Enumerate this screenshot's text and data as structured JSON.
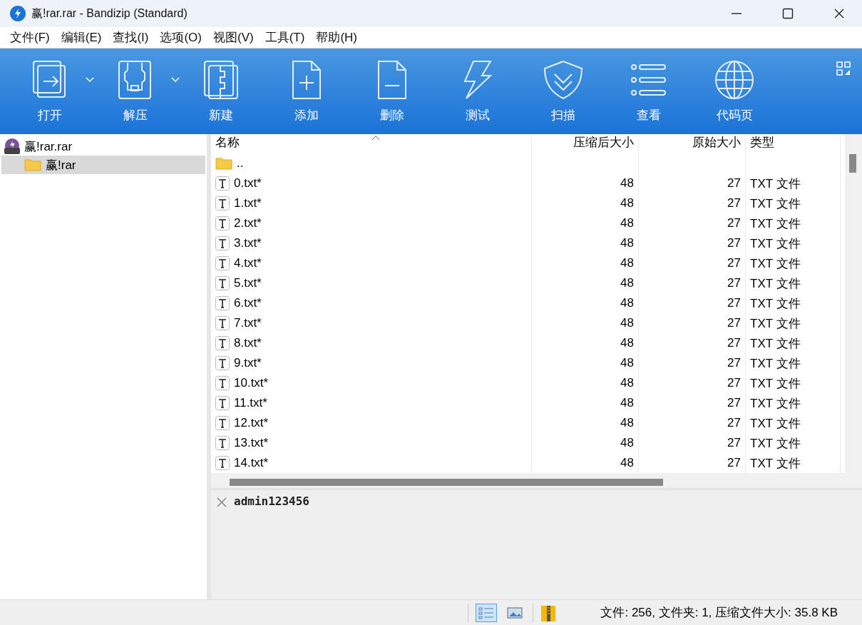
{
  "window": {
    "title": "赢!rar.rar - Bandizip (Standard)"
  },
  "menu": [
    "文件(F)",
    "编辑(E)",
    "查找(I)",
    "选项(O)",
    "视图(V)",
    "工具(T)",
    "帮助(H)"
  ],
  "toolbar": [
    {
      "label": "打开",
      "has_dropdown": true
    },
    {
      "label": "解压",
      "has_dropdown": true
    },
    {
      "label": "新建",
      "has_dropdown": false
    },
    {
      "label": "添加",
      "has_dropdown": false
    },
    {
      "label": "删除",
      "has_dropdown": false
    },
    {
      "label": "测试",
      "has_dropdown": false
    },
    {
      "label": "扫描",
      "has_dropdown": false
    },
    {
      "label": "查看",
      "has_dropdown": false
    },
    {
      "label": "代码页",
      "has_dropdown": false
    }
  ],
  "tree": [
    {
      "label": "赢!rar.rar",
      "selected": false,
      "children": [
        {
          "label": "赢!rar",
          "selected": true
        }
      ]
    }
  ],
  "table": {
    "columns": [
      {
        "label": "名称",
        "sorted": true
      },
      {
        "label": "压缩后大小",
        "sorted": false
      },
      {
        "label": "原始大小",
        "sorted": false
      },
      {
        "label": "类型",
        "sorted": false
      }
    ],
    "rows": [
      {
        "kind": "parent",
        "name": "..",
        "packed": "",
        "original": "",
        "type": ""
      },
      {
        "kind": "file",
        "name": "0.txt*",
        "packed": "48",
        "original": "27",
        "type": "TXT 文件"
      },
      {
        "kind": "file",
        "name": "1.txt*",
        "packed": "48",
        "original": "27",
        "type": "TXT 文件"
      },
      {
        "kind": "file",
        "name": "2.txt*",
        "packed": "48",
        "original": "27",
        "type": "TXT 文件"
      },
      {
        "kind": "file",
        "name": "3.txt*",
        "packed": "48",
        "original": "27",
        "type": "TXT 文件"
      },
      {
        "kind": "file",
        "name": "4.txt*",
        "packed": "48",
        "original": "27",
        "type": "TXT 文件"
      },
      {
        "kind": "file",
        "name": "5.txt*",
        "packed": "48",
        "original": "27",
        "type": "TXT 文件"
      },
      {
        "kind": "file",
        "name": "6.txt*",
        "packed": "48",
        "original": "27",
        "type": "TXT 文件"
      },
      {
        "kind": "file",
        "name": "7.txt*",
        "packed": "48",
        "original": "27",
        "type": "TXT 文件"
      },
      {
        "kind": "file",
        "name": "8.txt*",
        "packed": "48",
        "original": "27",
        "type": "TXT 文件"
      },
      {
        "kind": "file",
        "name": "9.txt*",
        "packed": "48",
        "original": "27",
        "type": "TXT 文件"
      },
      {
        "kind": "file",
        "name": "10.txt*",
        "packed": "48",
        "original": "27",
        "type": "TXT 文件"
      },
      {
        "kind": "file",
        "name": "11.txt*",
        "packed": "48",
        "original": "27",
        "type": "TXT 文件"
      },
      {
        "kind": "file",
        "name": "12.txt*",
        "packed": "48",
        "original": "27",
        "type": "TXT 文件"
      },
      {
        "kind": "file",
        "name": "13.txt*",
        "packed": "48",
        "original": "27",
        "type": "TXT 文件"
      },
      {
        "kind": "file",
        "name": "14.txt*",
        "packed": "48",
        "original": "27",
        "type": "TXT 文件"
      }
    ]
  },
  "comment": {
    "text": "admin123456"
  },
  "status_bar": {
    "view_buttons": [
      {
        "selected": true
      },
      {
        "selected": false
      }
    ],
    "text": "文件: 256, 文件夹: 1, 压缩文件大小: 35.8 KB"
  }
}
